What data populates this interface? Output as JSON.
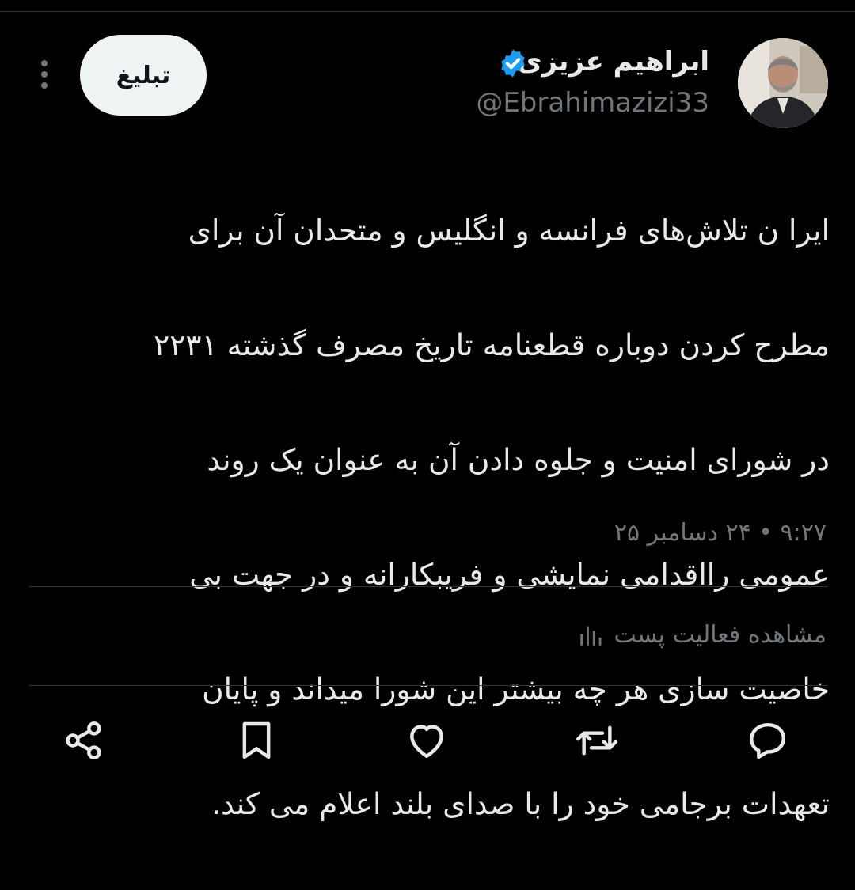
{
  "author": {
    "display_name": "ابراهیم عزیزی",
    "handle": "@Ebrahimazizi33",
    "verified": true,
    "avatar_icon": "profile-photo"
  },
  "header": {
    "follow_label": "تبلیغ",
    "more_icon": "more-vertical-icon"
  },
  "tweet": {
    "lines": [
      "ایرا ن تلاش‌های فرانسه و انگلیس و متحدان آن برای",
      "مطرح کردن دوباره قطعنامه تاریخ مصرف گذشته ۲۲۳۱",
      "در شورای امنیت و جلوه دادن آن به عنوان یک روند",
      "عمومی رااقدامی نمایشی و فریبکارانه و در جهت بی",
      "خاصیت سازی هر چه بیشتر این شورا میداند و پایان",
      "تعهدات برجامی خود را با صدای بلند اعلام می کند."
    ],
    "timestamp": "۹:۲۷ • ۲۴ دسامبر ۲۵"
  },
  "activity": {
    "label": "مشاهده فعالیت پست",
    "icon": "analytics-icon"
  },
  "actions": [
    "reply-icon",
    "retweet-icon",
    "like-icon",
    "bookmark-icon",
    "share-icon"
  ],
  "colors": {
    "background": "#000000",
    "text": "#e7e9ea",
    "secondary_text": "#71767b",
    "divider": "#2f3336",
    "verified_badge": "#1d9bf0",
    "button_bg": "#eff3f4"
  }
}
